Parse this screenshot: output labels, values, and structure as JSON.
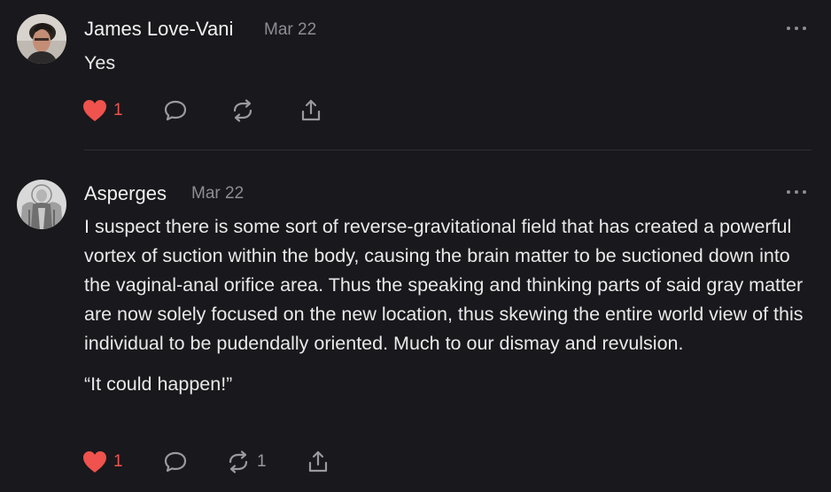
{
  "comments": [
    {
      "author": "James Love-Vani",
      "date": "Mar 22",
      "paragraphs": [
        "Yes"
      ],
      "likes": "1",
      "restacks": "",
      "avatar_icon": "person-photo-avatar"
    },
    {
      "author": "Asperges",
      "date": "Mar 22",
      "paragraphs": [
        "I suspect there is some sort of reverse-gravitational field that has created a powerful vortex of suction within the body, causing the brain matter to be suctioned down into the vaginal-anal orifice area. Thus the speaking and thinking parts of said gray matter are now solely focused on the new location, thus skewing the entire world view of this individual to be pudendally oriented. Much to our dismay and revulsion.",
        "“It could happen!”"
      ],
      "likes": "1",
      "restacks": "1",
      "avatar_icon": "icon-painting-avatar"
    }
  ],
  "colors": {
    "background": "#19181c",
    "like_red": "#f0524d",
    "muted": "#8d8d93"
  }
}
